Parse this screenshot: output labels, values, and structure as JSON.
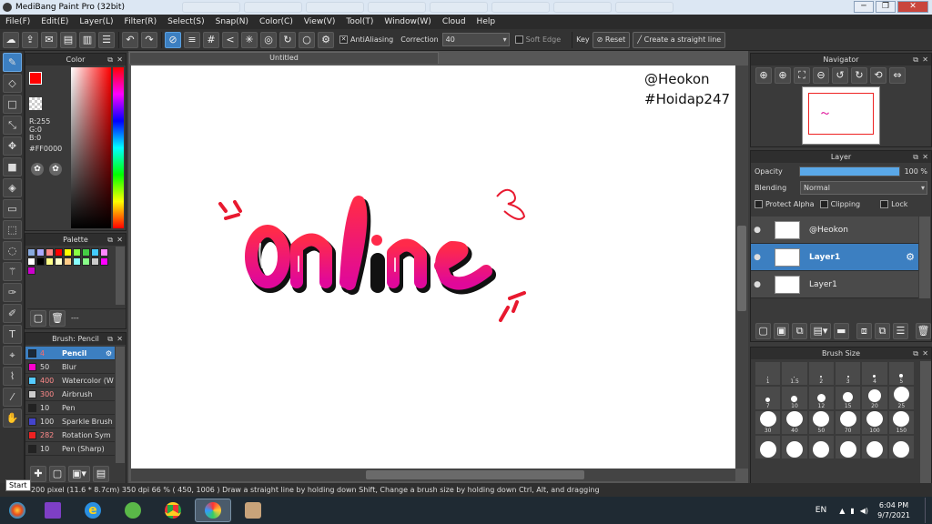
{
  "window": {
    "title": "MediBang Paint Pro (32bit)"
  },
  "menu": [
    "File(F)",
    "Edit(E)",
    "Layer(L)",
    "Filter(R)",
    "Select(S)",
    "Snap(N)",
    "Color(C)",
    "View(V)",
    "Tool(T)",
    "Window(W)",
    "Cloud",
    "Help"
  ],
  "toolbar": {
    "antialiasing_label": "AntiAliasing",
    "correction_label": "Correction",
    "correction_value": "40",
    "soft_edge_label": "Soft Edge",
    "key_label": "Key",
    "reset_label": "Reset",
    "straight_line_label": "Create a straight line"
  },
  "color_panel": {
    "title": "Color",
    "r": "R:255",
    "g": "G:0",
    "b": "B:0",
    "hex": "#FF0000",
    "foreground": "#ff0000"
  },
  "palette_panel": {
    "title": "Palette",
    "swatches": [
      "#8ad",
      "#aaf",
      "#f88",
      "#f00",
      "#ff0",
      "#8f4",
      "#4c4",
      "#4cf",
      "#f8f",
      "#fff",
      "#000",
      "#ff8",
      "#ffc",
      "#fc8",
      "#8ff",
      "#8f8",
      "#ccc",
      "#f0f",
      "#c0c"
    ],
    "footer_text": "---"
  },
  "brush_panel": {
    "title": "Brush: Pencil",
    "items": [
      {
        "size": "4",
        "name": "Pencil",
        "color": "#1a2a3a"
      },
      {
        "size": "50",
        "name": "Blur",
        "color": "#f0c"
      },
      {
        "size": "400",
        "name": "Watercolor (W",
        "color": "#5cf"
      },
      {
        "size": "300",
        "name": "Airbrush",
        "color": "#ccc"
      },
      {
        "size": "10",
        "name": "Pen",
        "color": "#222"
      },
      {
        "size": "100",
        "name": "Sparkle Brush",
        "color": "#44c"
      },
      {
        "size": "282",
        "name": "Rotation Sym",
        "color": "#e22"
      },
      {
        "size": "10",
        "name": "Pen (Sharp)",
        "color": "#222"
      }
    ]
  },
  "document": {
    "tab_title": "Untitled",
    "watermark_line1": "@Heokon",
    "watermark_line2": "#Hoidap247"
  },
  "navigator": {
    "title": "Navigator"
  },
  "layer_panel": {
    "title": "Layer",
    "opacity_label": "Opacity",
    "opacity_value": "100 %",
    "opacity_fraction": 1.0,
    "blending_label": "Blending",
    "blending_value": "Normal",
    "protect_alpha_label": "Protect Alpha",
    "clipping_label": "Clipping",
    "lock_label": "Lock",
    "layers": [
      {
        "name": "@Heokon",
        "selected": false
      },
      {
        "name": "Layer1",
        "selected": true
      },
      {
        "name": "Layer1",
        "selected": false
      }
    ]
  },
  "brush_size_panel": {
    "title": "Brush Size",
    "sizes": [
      "1",
      "1.5",
      "2",
      "3",
      "4",
      "5",
      "7",
      "10",
      "12",
      "15",
      "20",
      "25",
      "30",
      "40",
      "50",
      "70",
      "100",
      "150",
      "",
      "",
      "",
      "",
      "",
      ""
    ]
  },
  "statusbar": {
    "text": "200 pixel  (11.6 * 8.7cm)  350 dpi  66 %  ( 450, 1006 )  Draw a straight line by holding down Shift, Change a brush size by holding down Ctrl, Alt, and dragging",
    "tooltip": "Start"
  },
  "taskbar": {
    "lang": "EN",
    "time": "6:04 PM",
    "date": "9/7/2021"
  }
}
